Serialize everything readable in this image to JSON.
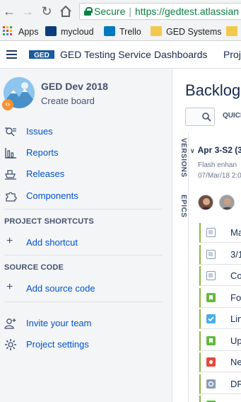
{
  "browser": {
    "secure_label": "Secure",
    "url": "https://gedtest.atlassian",
    "bookmarks": [
      "Apps",
      "mycloud",
      "Trello",
      "GED Systems"
    ]
  },
  "header": {
    "app_title": "GED Testing Service",
    "nav": [
      "Dashboards",
      "Proje"
    ]
  },
  "sidebar": {
    "project_name": "GED Dev 2018",
    "project_sub": "Create board",
    "items": [
      {
        "label": "Issues",
        "icon": "issues-icon"
      },
      {
        "label": "Reports",
        "icon": "reports-icon"
      },
      {
        "label": "Releases",
        "icon": "releases-icon"
      },
      {
        "label": "Components",
        "icon": "components-icon"
      }
    ],
    "shortcuts_title": "PROJECT SHORTCUTS",
    "add_shortcut": "Add shortcut",
    "source_title": "SOURCE CODE",
    "add_source": "Add source code",
    "invite": "Invite your team",
    "settings": "Project settings"
  },
  "main": {
    "title": "Backlog",
    "quick_filters": "QUICK",
    "tab_versions": "VERSIONS",
    "tab_epics": "EPICS",
    "sprint_title": "Apr 3-S2 (3",
    "sprint_desc": "Flash enhan",
    "sprint_date": "07/Mar/18 2:0",
    "issues": [
      {
        "title": "Ma",
        "type": "task",
        "color": "#8a9bb4"
      },
      {
        "title": "3/1",
        "type": "task",
        "color": "#8a9bb4"
      },
      {
        "title": "Co",
        "type": "task",
        "color": "#8a9bb4"
      },
      {
        "title": "Fo",
        "type": "story",
        "color": "#63ba3c"
      },
      {
        "title": "Lin",
        "type": "checkbox",
        "color": "#4bade8"
      },
      {
        "title": "Up",
        "type": "story",
        "color": "#63ba3c"
      },
      {
        "title": "Ne",
        "type": "bug",
        "color": "#e5493a"
      },
      {
        "title": "DR",
        "type": "subtask",
        "color": "#8a9bb4"
      },
      {
        "title": "Co",
        "type": "story",
        "color": "#63ba3c"
      }
    ]
  },
  "colors": {
    "link": "#0052cc",
    "sidebar_bg": "#f4f5f7",
    "epic_bar": "#8bb543"
  }
}
